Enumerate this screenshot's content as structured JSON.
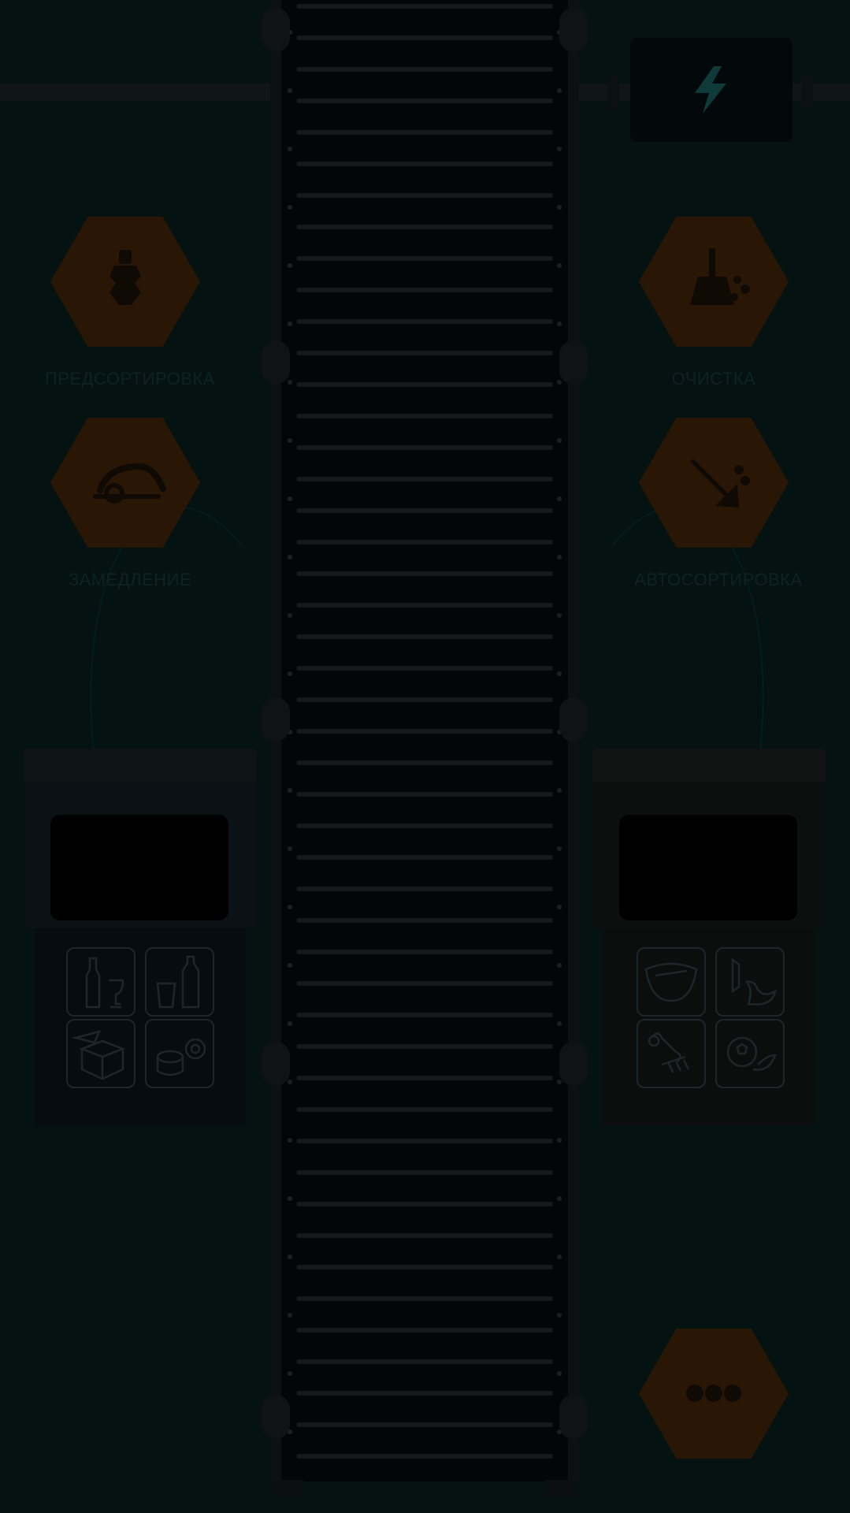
{
  "belt": {
    "label": "conveyor-belt"
  },
  "power": {
    "icon": "lightning-icon"
  },
  "actions": [
    {
      "id": "presort",
      "label": "ПРЕДСОРТИРОВКА",
      "icon": "bottle-stack-icon"
    },
    {
      "id": "clean",
      "label": "ОЧИСТКА",
      "icon": "broom-icon"
    },
    {
      "id": "slow",
      "label": "ЗАМЕДЛЕНИЕ",
      "icon": "snail-icon"
    },
    {
      "id": "autosort",
      "label": "АВТОСОРТИРОВКА",
      "icon": "sort-arrow-icon"
    },
    {
      "id": "more",
      "label": "",
      "icon": "more-dots-icon"
    }
  ],
  "bins": {
    "left": {
      "icons": [
        "glass-bottle-icon",
        "plastic-bottle-icon",
        "paper-box-icon",
        "metal-can-icon"
      ]
    },
    "right": {
      "icons": [
        "diaper-icon",
        "food-waste-icon",
        "bone-icon",
        "organic-icon"
      ]
    }
  },
  "colors": {
    "background": "#041312",
    "hex": "#2a1604",
    "belt": "#030507"
  }
}
